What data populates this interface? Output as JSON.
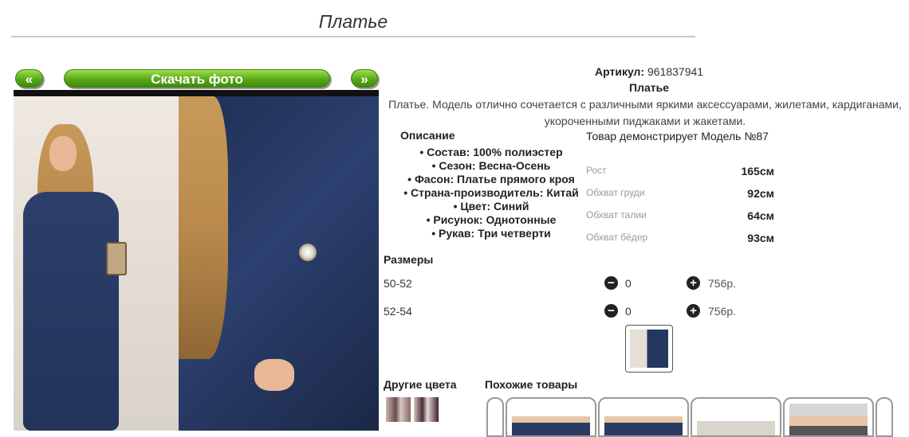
{
  "page": {
    "title": "Платье"
  },
  "gallery": {
    "prev_label": "«",
    "next_label": "»",
    "download_label": "Скачать фото"
  },
  "product": {
    "article_label": "Артикул:",
    "article_value": "961837941",
    "name": "Платье",
    "description": "Платье. Модель отлично сочетается с различными яркими аксессуарами, жилетами, кардиганами, укороченными пиджаками и жакетами."
  },
  "details": {
    "heading": "Описание",
    "items": [
      "Состав: 100% полиэстер",
      "Сезон: Весна-Осень",
      "Фасон: Платье прямого кроя",
      "Страна-производитель: Китай",
      "Цвет: Синий",
      "Рисунок: Однотонные",
      "Рукав: Три четверти"
    ]
  },
  "model": {
    "caption": "Товар демонстрирует Модель №87",
    "measurements": [
      {
        "label": "Рост",
        "value": "165см"
      },
      {
        "label": "Обхват груди",
        "value": "92см"
      },
      {
        "label": "Обхват талии",
        "value": "64см"
      },
      {
        "label": "Обхват бёдер",
        "value": "93см"
      }
    ]
  },
  "sizes": {
    "heading": "Размеры",
    "rows": [
      {
        "size": "50-52",
        "qty": "0",
        "price": "756р."
      },
      {
        "size": "52-54",
        "qty": "0",
        "price": "756р."
      }
    ],
    "minus_icon": "−",
    "plus_icon": "+"
  },
  "other_colors": {
    "heading": "Другие цвета"
  },
  "similar": {
    "heading": "Похожие товары"
  }
}
